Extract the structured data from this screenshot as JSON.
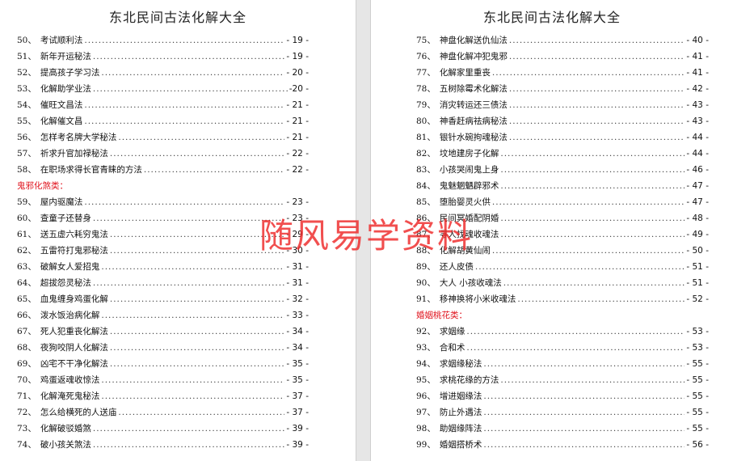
{
  "colors": {
    "category": "#e0141e",
    "watermark": "#ee2828"
  },
  "left": {
    "title": "东北民间古法化解大全",
    "entries": [
      {
        "num": "50、",
        "text": "考试顺利法",
        "page": "- 19 -"
      },
      {
        "num": "51、",
        "text": "新年开运秘法",
        "page": "- 19 -"
      },
      {
        "num": "52、",
        "text": "提高孩子学习法",
        "page": "- 20 -"
      },
      {
        "num": "53、",
        "text": "化解助学业法",
        "page": "-20 -"
      },
      {
        "num": "54、",
        "text": "催旺文昌法",
        "page": "- 21 -"
      },
      {
        "num": "55、",
        "text": "化解催文昌",
        "page": "- 21 -"
      },
      {
        "num": "56、",
        "text": "怎样考名牌大学秘法",
        "page": "- 21 -"
      },
      {
        "num": "57、",
        "text": "祈求升官加禄秘法",
        "page": "- 22 -"
      },
      {
        "num": "58、",
        "text": "在职场求得长官青睐的方法",
        "page": "- 22 -"
      },
      {
        "category": "鬼邪化煞类："
      },
      {
        "num": "59、",
        "text": "屋内驱魔法",
        "page": "- 23 -"
      },
      {
        "num": "60、",
        "text": "查童子还替身",
        "page": "- 23 -"
      },
      {
        "num": "61、",
        "text": "送五虚六耗穷鬼法",
        "page": "- 29 -"
      },
      {
        "num": "62、",
        "text": "五雷符打鬼邪秘法",
        "page": "- 30 -"
      },
      {
        "num": "63、",
        "text": "破解女人爱招鬼",
        "page": "- 31 -"
      },
      {
        "num": "64、",
        "text": "超拔怨灵秘法",
        "page": "- 31 -"
      },
      {
        "num": "65、",
        "text": "血鬼缠身鸡蛋化解",
        "page": "- 32 -"
      },
      {
        "num": "66、",
        "text": "泼水饭治病化解",
        "page": "- 33 -"
      },
      {
        "num": "67、",
        "text": "死人犯重丧化解法",
        "page": "- 34 -"
      },
      {
        "num": "68、",
        "text": "夜狗咬阴人化解法",
        "page": "- 34 -"
      },
      {
        "num": "69、",
        "text": "凶宅不干净化解法",
        "page": "- 35 -"
      },
      {
        "num": "70、",
        "text": "鸡蛋返魂收惊法",
        "page": "- 35 -"
      },
      {
        "num": "71、",
        "text": "化解淹死鬼秘法",
        "page": "- 37 -"
      },
      {
        "num": "72、",
        "text": "怎么给横死的人送庙",
        "page": "- 37 -"
      },
      {
        "num": "73、",
        "text": "化解破驳婚煞",
        "page": "- 39 -"
      },
      {
        "num": "74、",
        "text": "破小孩关煞法",
        "page": "- 39 -"
      }
    ]
  },
  "right": {
    "title": "东北民间古法化解大全",
    "entries": [
      {
        "num": "75、",
        "text": "神盘化解送仇仙法",
        "page": "- 40 -"
      },
      {
        "num": "76、",
        "text": "神盘化解冲犯鬼邪",
        "page": "- 41 -"
      },
      {
        "num": "77、",
        "text": "化解家里重丧",
        "page": "- 41 -"
      },
      {
        "num": "78、",
        "text": "五树除霉术化解法",
        "page": "- 42 -"
      },
      {
        "num": "79、",
        "text": "消灾转运还三债法",
        "page": "- 43 -"
      },
      {
        "num": "80、",
        "text": "神香赶病祛病秘法",
        "page": "- 43 -"
      },
      {
        "num": "81、",
        "text": "银针水碗拘魂秘法",
        "page": "- 44 -"
      },
      {
        "num": "82、",
        "text": "坟地建房子化解",
        "page": "- 44 -"
      },
      {
        "num": "83、",
        "text": "小孩哭闹鬼上身",
        "page": "- 46 -"
      },
      {
        "num": "84、",
        "text": "鬼魅魍魉辟邪术",
        "page": "- 47 -"
      },
      {
        "num": "85、",
        "text": "堕胎婴灵火供",
        "page": "- 47 -"
      },
      {
        "num": "86、",
        "text": "民间冥婚配阴婚",
        "page": "- 48 -"
      },
      {
        "num": "87、",
        "text": "寻人找魂收魂法",
        "page": "- 49 -"
      },
      {
        "num": "88、",
        "text": "化解胡黄仙闹",
        "page": "- 50 -"
      },
      {
        "num": "89、",
        "text": "还人皮债",
        "page": "- 51 -"
      },
      {
        "num": "90、",
        "text": "大人  小孩收魂法",
        "page": "- 51 -"
      },
      {
        "num": "91、",
        "text": "移神换将小米收魂法",
        "page": "- 52 -"
      },
      {
        "category": "婚姻桃花类："
      },
      {
        "num": "92、",
        "text": "求姻缘",
        "page": "- 53 -"
      },
      {
        "num": "93、",
        "text": "合和术",
        "page": "- 53 -"
      },
      {
        "num": "94、",
        "text": "求姻缘秘法",
        "page": "- 55 -"
      },
      {
        "num": "95、",
        "text": "求桃花缘的方法",
        "page": "- 55 -"
      },
      {
        "num": "96、",
        "text": "增进姻缘法",
        "page": "- 55 -"
      },
      {
        "num": "97、",
        "text": "防止外遇法",
        "page": "- 55 -"
      },
      {
        "num": "98、",
        "text": "助姻缘阵法",
        "page": "- 55 -"
      },
      {
        "num": "99、",
        "text": "婚姻搭桥术",
        "page": "- 56 -"
      }
    ]
  },
  "watermark": "随风易学资料"
}
